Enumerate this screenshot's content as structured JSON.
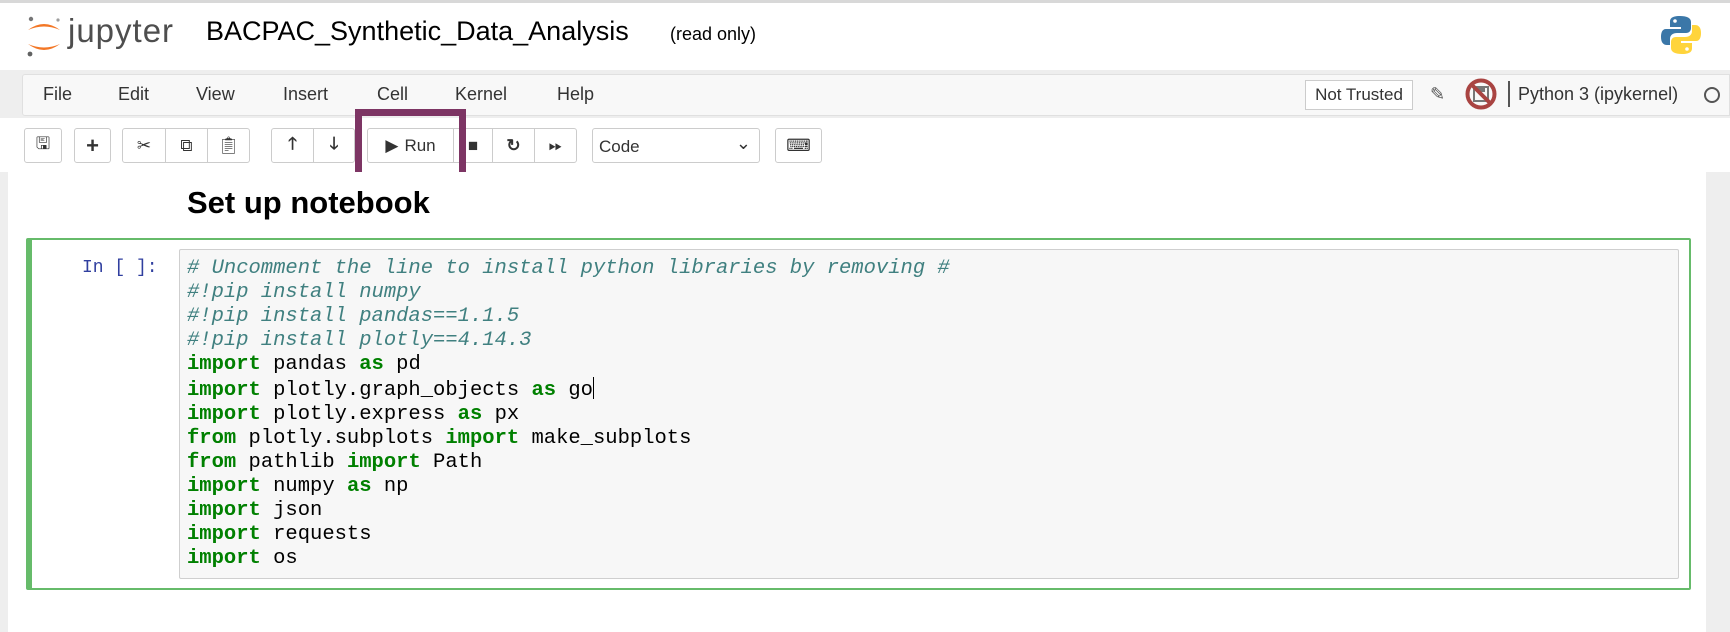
{
  "header": {
    "logo_text": "jupyter",
    "notebook_title": "BACPAC_Synthetic_Data_Analysis",
    "read_only_label": "(read only)",
    "kernel_logo": "python-logo-icon"
  },
  "menubar": {
    "items": [
      "File",
      "Edit",
      "View",
      "Insert",
      "Cell",
      "Kernel",
      "Help"
    ],
    "trusted_label": "Not Trusted",
    "kernel_name": "Python 3 (ipykernel)",
    "kernel_status": "idle"
  },
  "toolbar": {
    "run_label": "Run",
    "cell_type": "Code",
    "icons": [
      "save-icon",
      "plus-icon",
      "cut-icon",
      "copy-icon",
      "paste-icon",
      "arrow-up-icon",
      "arrow-down-icon",
      "play-icon",
      "stop-icon",
      "restart-icon",
      "fast-forward-icon",
      "keyboard-icon"
    ],
    "highlight_color": "#7d3564"
  },
  "notebook": {
    "heading": "Set up notebook",
    "cell": {
      "prompt": "In [ ]:",
      "border_color": "#66bb6a",
      "lines": [
        [
          {
            "t": "# Uncomment the line to install python libraries by removing #",
            "k": "comment"
          }
        ],
        [
          {
            "t": "#!pip install numpy",
            "k": "comment"
          }
        ],
        [
          {
            "t": "#!pip install pandas==1.1.5",
            "k": "comment"
          }
        ],
        [
          {
            "t": "#!pip install plotly==4.14.3",
            "k": "comment"
          }
        ],
        [
          {
            "t": "import",
            "k": "kw"
          },
          {
            "t": " pandas ",
            "k": "plain"
          },
          {
            "t": "as",
            "k": "kw"
          },
          {
            "t": " pd",
            "k": "plain"
          }
        ],
        [
          {
            "t": "import",
            "k": "kw"
          },
          {
            "t": " plotly.graph_objects ",
            "k": "plain"
          },
          {
            "t": "as",
            "k": "kw"
          },
          {
            "t": " go",
            "k": "plain"
          }
        ],
        [
          {
            "t": "import",
            "k": "kw"
          },
          {
            "t": " plotly.express ",
            "k": "plain"
          },
          {
            "t": "as",
            "k": "kw"
          },
          {
            "t": " px",
            "k": "plain"
          }
        ],
        [
          {
            "t": "from",
            "k": "kw"
          },
          {
            "t": " plotly.subplots ",
            "k": "plain"
          },
          {
            "t": "import",
            "k": "kw"
          },
          {
            "t": " make_subplots",
            "k": "plain"
          }
        ],
        [
          {
            "t": "from",
            "k": "kw"
          },
          {
            "t": " pathlib ",
            "k": "plain"
          },
          {
            "t": "import",
            "k": "kw"
          },
          {
            "t": " Path",
            "k": "plain"
          }
        ],
        [
          {
            "t": "import",
            "k": "kw"
          },
          {
            "t": " numpy ",
            "k": "plain"
          },
          {
            "t": "as",
            "k": "kw"
          },
          {
            "t": " np",
            "k": "plain"
          }
        ],
        [
          {
            "t": "import",
            "k": "kw"
          },
          {
            "t": " json",
            "k": "plain"
          }
        ],
        [
          {
            "t": "import",
            "k": "kw"
          },
          {
            "t": " requests",
            "k": "plain"
          }
        ],
        [
          {
            "t": "import",
            "k": "kw"
          },
          {
            "t": " os",
            "k": "plain"
          }
        ]
      ]
    }
  }
}
